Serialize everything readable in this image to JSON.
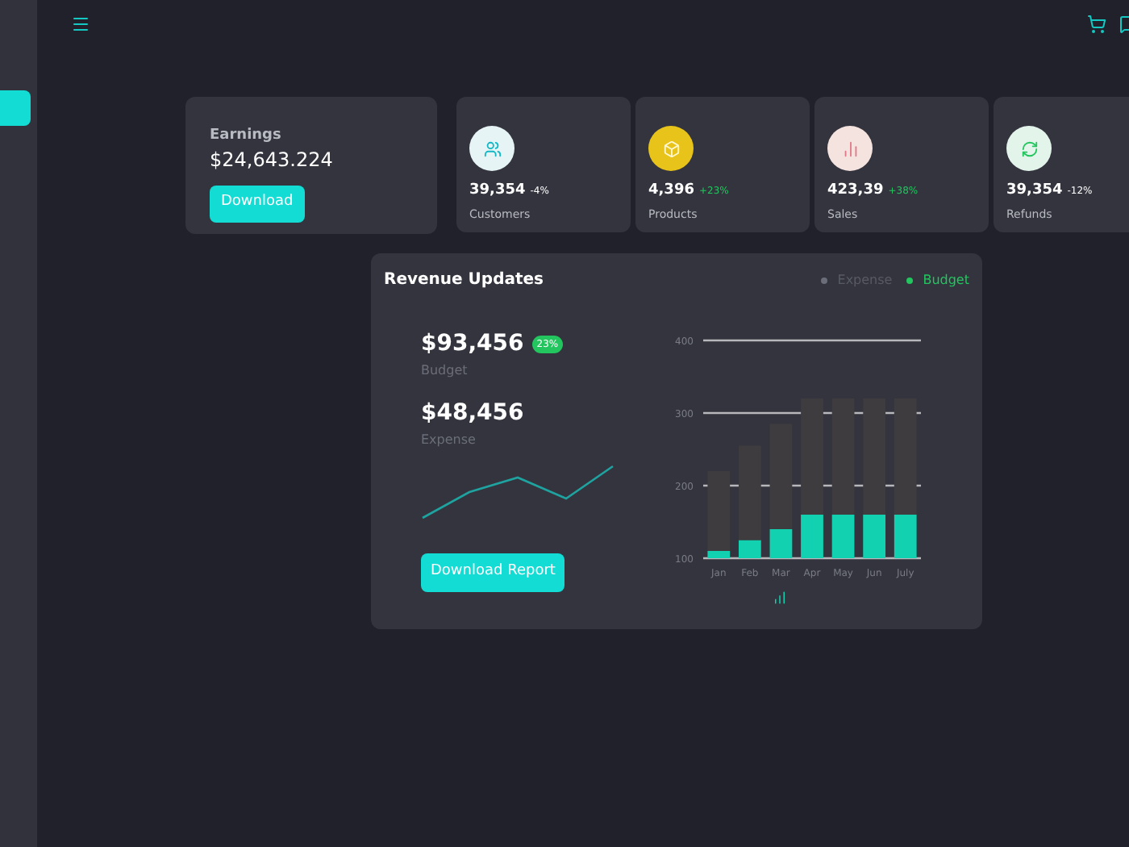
{
  "earnings": {
    "label": "Earnings",
    "amount": "$24,643.224",
    "button": "Download"
  },
  "stats": [
    {
      "value": "39,354",
      "change": "-4%",
      "kind": "down",
      "label": "Customers",
      "color": "#e6f4f6"
    },
    {
      "value": "4,396",
      "change": "+23%",
      "kind": "up",
      "label": "Products",
      "color": "#e8c31a"
    },
    {
      "value": "423,39",
      "change": "+38%",
      "kind": "up",
      "label": "Sales",
      "color": "#f5e3df"
    },
    {
      "value": "39,354",
      "change": "-12%",
      "kind": "down",
      "label": "Refunds",
      "color": "#e3f4ea"
    }
  ],
  "revenue": {
    "title": "Revenue Updates",
    "legend": [
      {
        "label": "Expense",
        "color": "#6b6e78",
        "selected": false
      },
      {
        "label": "Budget",
        "color": "#22c55e",
        "selected": true
      }
    ],
    "budget": {
      "amount": "$93,456",
      "label": "Budget",
      "badge": "23%"
    },
    "expense": {
      "amount": "$48,456",
      "label": "Expense"
    },
    "button": "Download Report",
    "chart_data": {
      "type": "bar",
      "stacked": true,
      "categories": [
        "Jan",
        "Feb",
        "Mar",
        "Apr",
        "May",
        "Jun",
        "July"
      ],
      "ylim": [
        100,
        400
      ],
      "yticks": [
        100,
        200,
        300,
        400
      ],
      "series": [
        {
          "color": "#12d1b0",
          "values": [
            110,
            125,
            140,
            160,
            160,
            160,
            160
          ]
        },
        {
          "color": "#3e3c3f",
          "values": [
            110,
            130,
            145,
            160,
            160,
            160,
            160
          ]
        }
      ]
    }
  }
}
